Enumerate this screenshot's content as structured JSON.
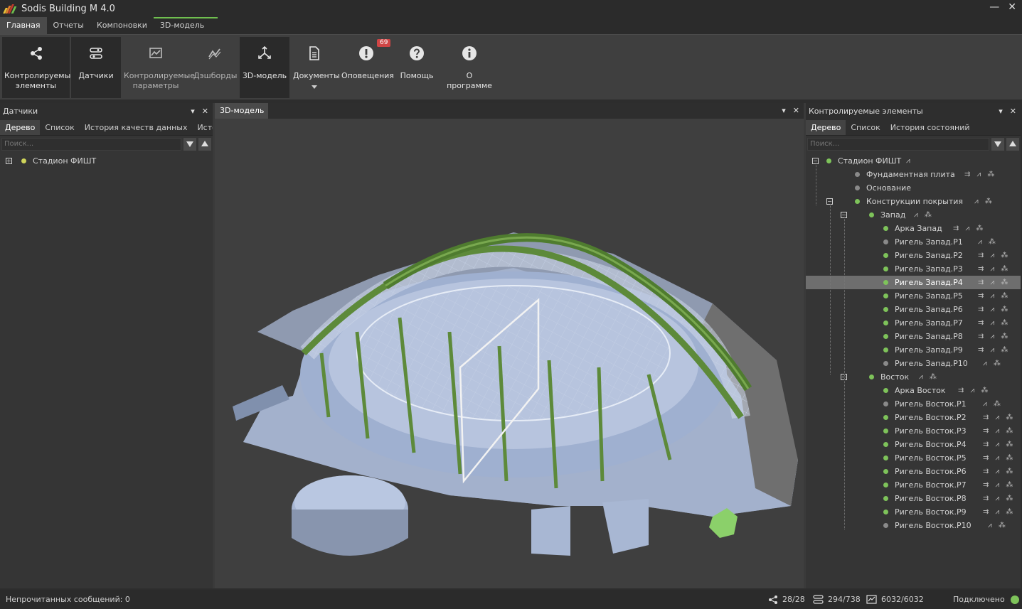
{
  "app": {
    "title": "Sodis Building M 4.0",
    "minimize": "—",
    "close": "✕"
  },
  "menu": {
    "tabs": [
      "Главная",
      "Отчеты",
      "Компоновки",
      "3D-модель"
    ]
  },
  "ribbon": {
    "buttons": [
      {
        "label": "Контролируемые элементы",
        "icon": "share-icon"
      },
      {
        "label": "Датчики",
        "icon": "sensor-icon"
      },
      {
        "label": "Контролируемые параметры",
        "icon": "chart-icon"
      },
      {
        "label": "Дэшборды",
        "icon": "trend-icon"
      },
      {
        "label": "3D-модель",
        "icon": "model-icon"
      },
      {
        "label": "Документы",
        "icon": "document-icon"
      },
      {
        "label": "Оповещения",
        "icon": "alert-icon",
        "badge": "69"
      },
      {
        "label": "Помощь",
        "icon": "help-icon"
      },
      {
        "label": "О программе",
        "icon": "info-icon"
      }
    ]
  },
  "left_panel": {
    "title": "Датчики",
    "tabs": [
      "Дерево",
      "Список",
      "История качеств данных",
      "Истори"
    ],
    "search_placeholder": "Поиск...",
    "tree": [
      {
        "label": "Стадион ФИШТ",
        "status": "yellow"
      }
    ]
  },
  "viewport": {
    "tab": "3D-модель"
  },
  "right_panel": {
    "title": "Контролируемые элементы",
    "tabs": [
      "Дерево",
      "Список",
      "История состояний"
    ],
    "search_placeholder": "Поиск...",
    "tree": [
      {
        "label": "Стадион ФИШТ",
        "level": 0,
        "status": "green",
        "expander": "⊟",
        "actions": "⩘"
      },
      {
        "label": "Фундаментная плита",
        "level": 1,
        "status": "gray",
        "actions": "⇉ ⩘ ⁂"
      },
      {
        "label": "Основание",
        "level": 1,
        "status": "gray",
        "actions": ""
      },
      {
        "label": "Конструкции покрытия",
        "level": 1,
        "status": "green",
        "expander": "⊟",
        "actions": "⩘ ⁂"
      },
      {
        "label": "Запад",
        "level": 2,
        "status": "green",
        "expander": "⊟",
        "actions": "⩘ ⁂"
      },
      {
        "label": "Арка Запад",
        "level": 3,
        "status": "green",
        "actions": "⇉ ⩘ ⁂"
      },
      {
        "label": "Ригель Запад.Р1",
        "level": 3,
        "status": "gray",
        "actions": "⩘ ⁂"
      },
      {
        "label": "Ригель Запад.Р2",
        "level": 3,
        "status": "green",
        "actions": "⇉ ⩘ ⁂"
      },
      {
        "label": "Ригель Запад.Р3",
        "level": 3,
        "status": "green",
        "actions": "⇉ ⩘ ⁂"
      },
      {
        "label": "Ригель Запад.Р4",
        "level": 3,
        "status": "green",
        "actions": "⇉ ⩘ ⁂",
        "selected": true
      },
      {
        "label": "Ригель Запад.Р5",
        "level": 3,
        "status": "green",
        "actions": "⇉ ⩘ ⁂"
      },
      {
        "label": "Ригель Запад.Р6",
        "level": 3,
        "status": "green",
        "actions": "⇉ ⩘ ⁂"
      },
      {
        "label": "Ригель Запад.Р7",
        "level": 3,
        "status": "green",
        "actions": "⇉ ⩘ ⁂"
      },
      {
        "label": "Ригель Запад.Р8",
        "level": 3,
        "status": "green",
        "actions": "⇉ ⩘ ⁂"
      },
      {
        "label": "Ригель Запад.Р9",
        "level": 3,
        "status": "green",
        "actions": "⇉ ⩘ ⁂"
      },
      {
        "label": "Ригель Запад.Р10",
        "level": 3,
        "status": "gray",
        "actions": "⩘ ⁂"
      },
      {
        "label": "Восток",
        "level": 2,
        "status": "green",
        "expander": "⊟",
        "actions": "⩘ ⁂"
      },
      {
        "label": "Арка Восток",
        "level": 3,
        "status": "green",
        "actions": "⇉ ⩘ ⁂"
      },
      {
        "label": "Ригель Восток.Р1",
        "level": 3,
        "status": "gray",
        "actions": "⩘ ⁂"
      },
      {
        "label": "Ригель Восток.Р2",
        "level": 3,
        "status": "green",
        "actions": "⇉ ⩘ ⁂"
      },
      {
        "label": "Ригель Восток.Р3",
        "level": 3,
        "status": "green",
        "actions": "⇉ ⩘ ⁂"
      },
      {
        "label": "Ригель Восток.Р4",
        "level": 3,
        "status": "green",
        "actions": "⇉ ⩘ ⁂"
      },
      {
        "label": "Ригель Восток.Р5",
        "level": 3,
        "status": "green",
        "actions": "⇉ ⩘ ⁂"
      },
      {
        "label": "Ригель Восток.Р6",
        "level": 3,
        "status": "green",
        "actions": "⇉ ⩘ ⁂"
      },
      {
        "label": "Ригель Восток.Р7",
        "level": 3,
        "status": "green",
        "actions": "⇉ ⩘ ⁂"
      },
      {
        "label": "Ригель Восток.Р8",
        "level": 3,
        "status": "green",
        "actions": "⇉ ⩘ ⁂"
      },
      {
        "label": "Ригель Восток.Р9",
        "level": 3,
        "status": "green",
        "actions": "⇉ ⩘ ⁂"
      },
      {
        "label": "Ригель Восток.Р10",
        "level": 3,
        "status": "gray",
        "actions": "⩘ ⁂"
      }
    ]
  },
  "status": {
    "unread": "Непрочитанных сообщений: 0",
    "elements": "28/28",
    "sensors": "294/738",
    "params": "6032/6032",
    "connection": "Подключено"
  },
  "colors": {
    "accent": "#6fbf4f",
    "ok": "#7ec35a",
    "warn": "#cfd45a",
    "inactive": "#8a8a8a",
    "alert_badge": "#d04545"
  }
}
